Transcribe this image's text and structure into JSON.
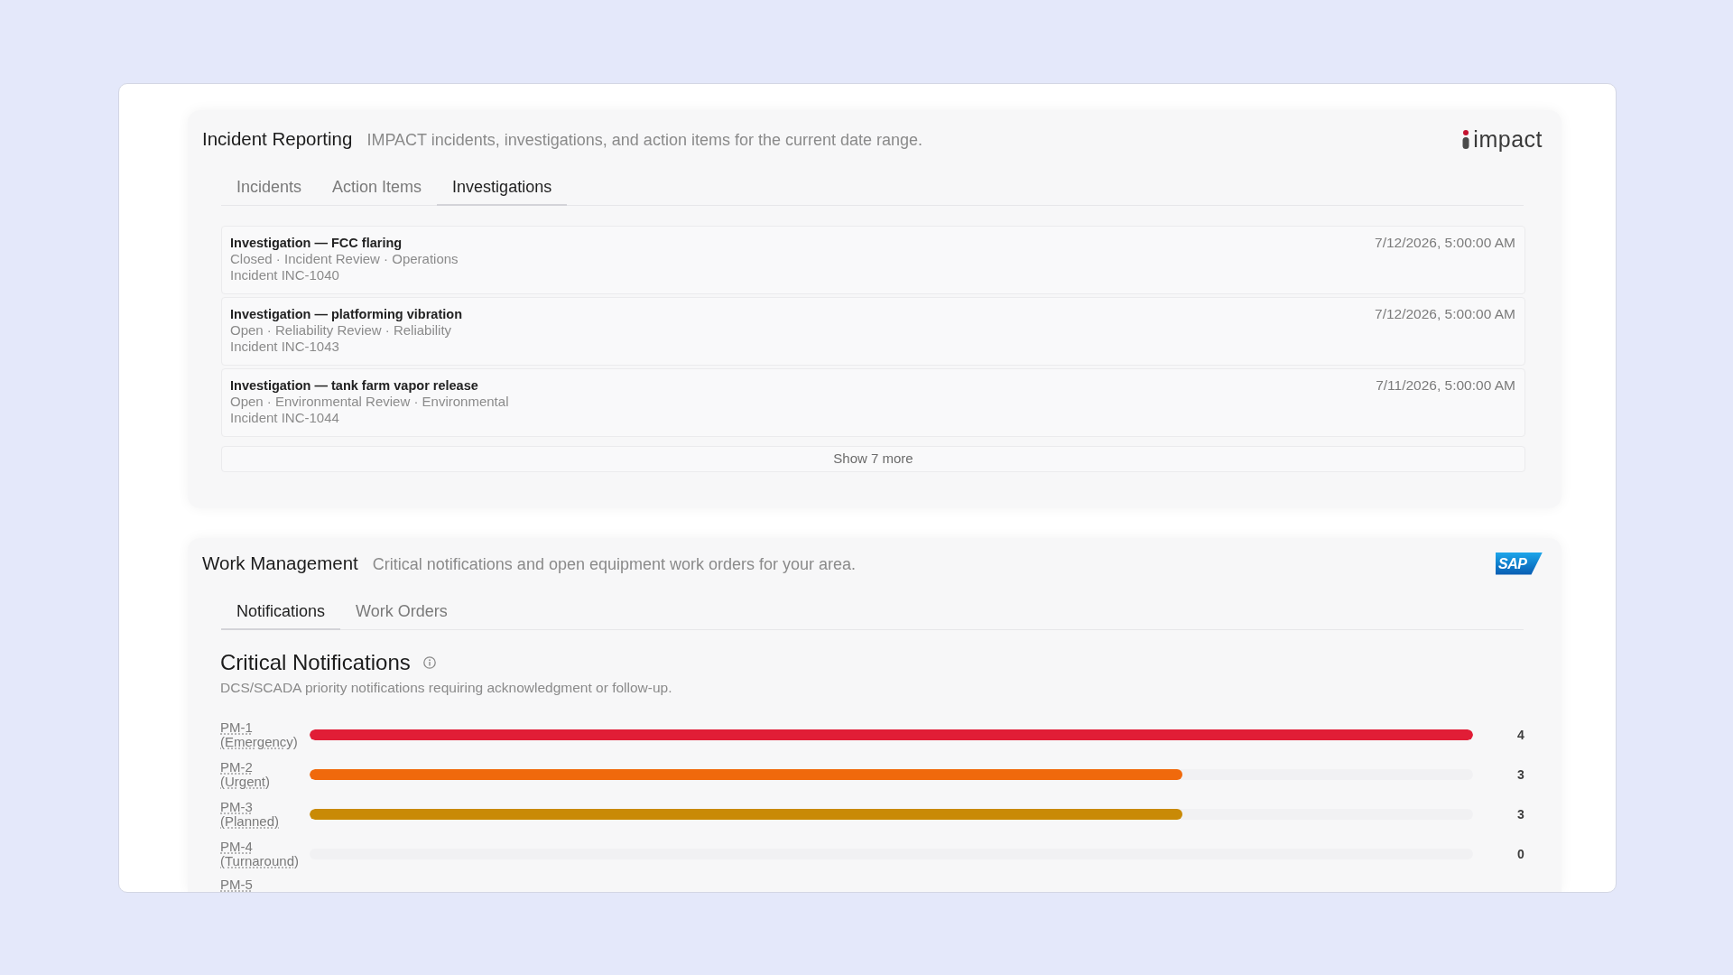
{
  "incident_reporting": {
    "title": "Incident Reporting",
    "description": "IMPACT incidents, investigations, and action items for the current date range.",
    "logo_text": "impact",
    "tabs": [
      {
        "label": "Incidents",
        "selected": false
      },
      {
        "label": "Action Items",
        "selected": false
      },
      {
        "label": "Investigations",
        "selected": true
      }
    ],
    "investigations": [
      {
        "title": "Investigation — FCC flaring",
        "meta": "Closed · Incident Review · Operations",
        "incident": "Incident INC-1040",
        "date": "7/12/2026, 5:00:00 AM"
      },
      {
        "title": "Investigation — platforming vibration",
        "meta": "Open · Reliability Review · Reliability",
        "incident": "Incident INC-1043",
        "date": "7/12/2026, 5:00:00 AM"
      },
      {
        "title": "Investigation — tank farm vapor release",
        "meta": "Open · Environmental Review · Environmental",
        "incident": "Incident INC-1044",
        "date": "7/11/2026, 5:00:00 AM"
      }
    ],
    "show_more": "Show 7 more"
  },
  "work_management": {
    "title": "Work Management",
    "description": "Critical notifications and open equipment work orders for your area.",
    "logo_text": "SAP",
    "tabs": [
      {
        "label": "Notifications",
        "selected": true
      },
      {
        "label": "Work Orders",
        "selected": false
      }
    ],
    "critical_notifications": {
      "title": "Critical Notifications",
      "subtitle": "DCS/SCADA priority notifications requiring acknowledgment or follow-up.",
      "rows": [
        {
          "label": "PM-1 (Emergency)",
          "level": 1,
          "reading": "4",
          "color": "#e11d36"
        },
        {
          "label": "PM-2 (Urgent)",
          "level": 0.75,
          "reading": "3",
          "color": "#f0690c"
        },
        {
          "label": "PM-3 (Planned)",
          "level": 0.75,
          "reading": "3",
          "color": "#c98a06"
        },
        {
          "label": "PM-4 (Turnaround)",
          "reading": "0"
        }
      ],
      "partial_row": {
        "label": "PM-5"
      }
    }
  }
}
